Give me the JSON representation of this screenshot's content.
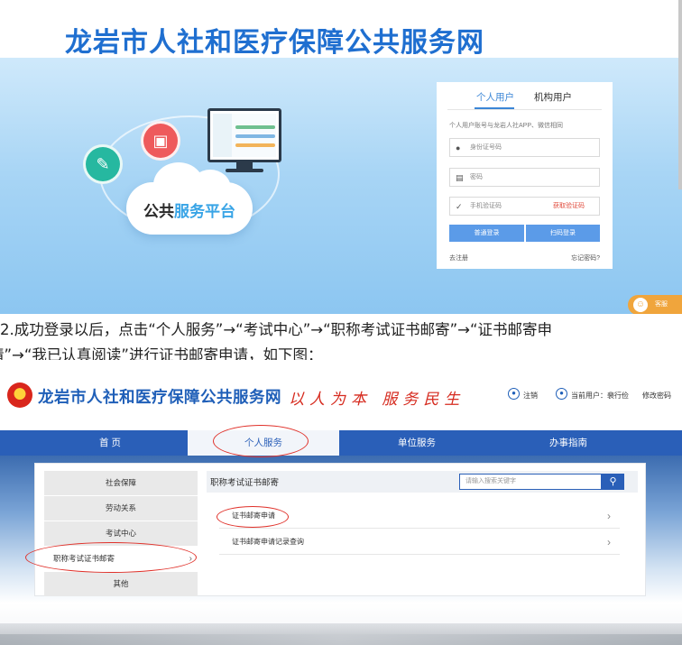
{
  "login_page": {
    "site_title": "龙岩市人社和医疗保障公共服务网",
    "cloud_label_part1": "公共",
    "cloud_label_part2": "服务平台",
    "tabs": [
      "个人用户",
      "机构用户"
    ],
    "hint": "个人用户账号与龙岩人社APP、微信相同",
    "id_placeholder": "身份证号码",
    "password_placeholder": "密码",
    "sms_placeholder": "手机验证码",
    "get_code_label": "获取验证码",
    "login_button": "普通登录",
    "scan_button": "扫码登录",
    "register_link": "去注册",
    "forgot_link": "忘记密码?",
    "helper_label": "客服",
    "colors": {
      "banner_title": "#1f6fd0",
      "primary_button": "#5b9be8",
      "hero_sky": "#a8d5f5"
    },
    "icons": [
      "certificate-icon",
      "id-card-icon",
      "monitor-icon",
      "user-icon",
      "lock-icon",
      "shield-icon",
      "headset-icon"
    ]
  },
  "instruction": {
    "line1": "2.成功登录以后，点击“个人服务”→“考试中心”→“职称考试证书邮寄”→“证书邮寄申",
    "line2": "请”→“我已认真阅读”进行证书邮寄申请，如下图："
  },
  "portal": {
    "site_title": "龙岩市人社和医疗保障公共服务网",
    "slogan": "以人为本 服务民生",
    "logout_label": "注销",
    "current_user_label": "当前用户：裴行俭",
    "change_password_label": "修改密码",
    "nav": [
      "首 页",
      "个人服务",
      "单位服务",
      "办事指南"
    ],
    "active_nav": "个人服务",
    "sidebar": [
      "社会保障",
      "劳动关系",
      "考试中心",
      "职称考试证书邮寄",
      "其他"
    ],
    "active_sidebar": "职称考试证书邮寄",
    "section_title": "职称考试证书邮寄",
    "search_placeholder": "请输入搜索关键字",
    "services": [
      "证书邮寄申请",
      "证书邮寄申请记录查询"
    ],
    "colors": {
      "nav_bar": "#2a5fb8",
      "highlight_ellipse": "#e0312a",
      "slogan": "#d62b1f"
    }
  }
}
